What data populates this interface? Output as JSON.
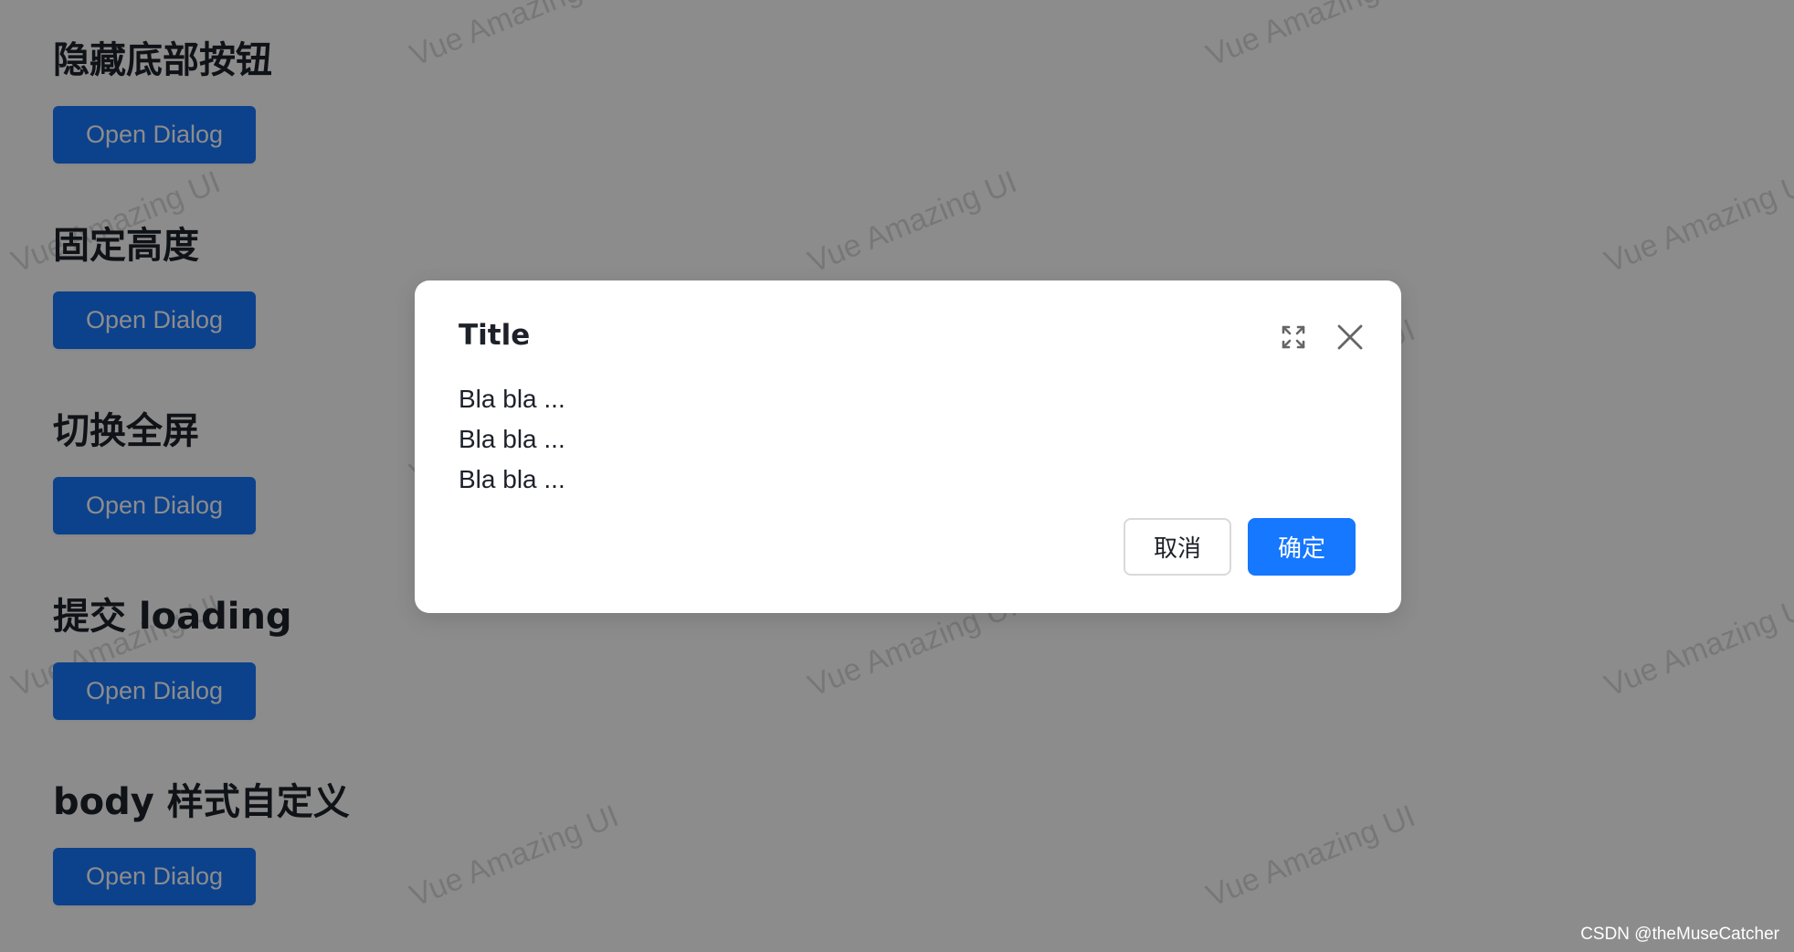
{
  "sections": [
    {
      "title": "隐藏底部按钮",
      "button_label": "Open Dialog"
    },
    {
      "title": "固定高度",
      "button_label": "Open Dialog"
    },
    {
      "title": "切换全屏",
      "button_label": "Open Dialog"
    },
    {
      "title": "提交 loading",
      "button_label": "Open Dialog"
    },
    {
      "title": "body 样式自定义",
      "button_label": "Open Dialog"
    }
  ],
  "watermark": {
    "text": "Vue Amazing UI"
  },
  "dialog": {
    "title": "Title",
    "body_lines": [
      "Bla bla ...",
      "Bla bla ...",
      "Bla bla ..."
    ],
    "cancel_label": "取消",
    "ok_label": "确定",
    "icons": [
      "fullscreen-icon",
      "close-icon"
    ]
  },
  "credit": "CSDN @theMuseCatcher",
  "colors": {
    "primary": "#1677ff",
    "overlay": "rgba(0,0,0,0.45)",
    "text": "#1d2129",
    "icon": "#666666"
  }
}
